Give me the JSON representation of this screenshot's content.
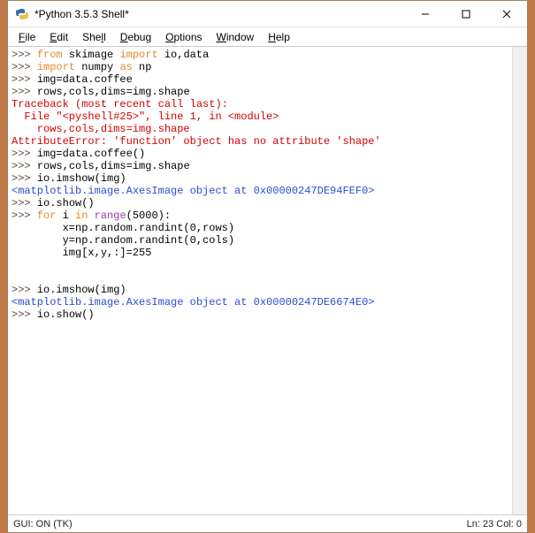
{
  "window": {
    "title": "*Python 3.5.3 Shell*"
  },
  "menu": {
    "file": "File",
    "edit": "Edit",
    "shell": "Shell",
    "debug": "Debug",
    "options": "Options",
    "window": "Window",
    "help": "Help"
  },
  "code": {
    "l1a": ">>> ",
    "l1b": "from",
    "l1c": " skimage ",
    "l1d": "import",
    "l1e": " io,data",
    "l2a": ">>> ",
    "l2b": "import",
    "l2c": " numpy ",
    "l2d": "as",
    "l2e": " np",
    "l3a": ">>> ",
    "l3b": "img=data.coffee",
    "l4a": ">>> ",
    "l4b": "rows,cols,dims=img.shape",
    "l5": "Traceback (most recent call last):",
    "l6": "  File \"<pyshell#25>\", line 1, in <module>",
    "l7": "    rows,cols,dims=img.shape",
    "l8": "AttributeError: 'function' object has no attribute 'shape'",
    "l9a": ">>> ",
    "l9b": "img=data.coffee()",
    "l10a": ">>> ",
    "l10b": "rows,cols,dims=img.shape",
    "l11a": ">>> ",
    "l11b": "io.imshow(img)",
    "l12": "<matplotlib.image.AxesImage object at 0x00000247DE94FEF0>",
    "l13a": ">>> ",
    "l13b": "io.show()",
    "l14a": ">>> ",
    "l14b": "for",
    "l14c": " i ",
    "l14d": "in",
    "l14e": " ",
    "l14f": "range",
    "l14g": "(5000):",
    "l15": "\tx=np.random.randint(0,rows)",
    "l16": "\ty=np.random.randint(0,cols)",
    "l17": "\timg[x,y,:]=255",
    "l18": "",
    "l19": "\t",
    "l20a": ">>> ",
    "l20b": "io.imshow(img)",
    "l21": "<matplotlib.image.AxesImage object at 0x00000247DE6674E0>",
    "l22a": ">>> ",
    "l22b": "io.show()"
  },
  "status": {
    "left": "GUI: ON (TK)",
    "right": "Ln: 23  Col: 0"
  }
}
